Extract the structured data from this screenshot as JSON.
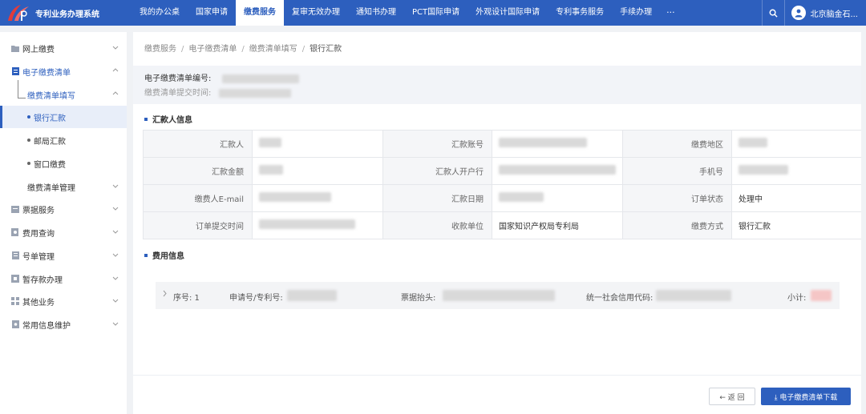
{
  "app": {
    "title": "专利业务办理系统"
  },
  "nav": {
    "items": [
      "我的办公桌",
      "国家申请",
      "缴费服务",
      "复审无效办理",
      "通知书办理",
      "PCT国际申请",
      "外观设计国际申请",
      "专利事务服务",
      "手续办理"
    ],
    "active_index": 2,
    "more_label": "···"
  },
  "user": {
    "name": "北京脑金石..."
  },
  "sidebar": {
    "items": [
      {
        "label": "网上缴费",
        "icon": "folder-icon"
      },
      {
        "label": "电子缴费清单",
        "icon": "document-icon"
      },
      {
        "label": "缴费清单填写"
      },
      {
        "label": "银行汇款"
      },
      {
        "label": "邮局汇款"
      },
      {
        "label": "窗口缴费"
      },
      {
        "label": "缴费清单管理"
      },
      {
        "label": "票据服务",
        "icon": "receipt-icon"
      },
      {
        "label": "费用查询",
        "icon": "search-doc-icon"
      },
      {
        "label": "号单管理",
        "icon": "list-icon"
      },
      {
        "label": "暂存款办理",
        "icon": "deposit-icon"
      },
      {
        "label": "其他业务",
        "icon": "grid-icon"
      },
      {
        "label": "常用信息维护",
        "icon": "settings-doc-icon"
      }
    ]
  },
  "breadcrumb": [
    "缴费服务",
    "电子缴费清单",
    "缴费清单填写",
    "银行汇款"
  ],
  "info": {
    "list_no_label": "电子缴费清单编号:",
    "submit_time_label": "缴费清单提交时间:"
  },
  "sections": {
    "remitter_title": "汇款人信息",
    "fee_title": "费用信息"
  },
  "detail": {
    "rows": [
      [
        {
          "label": "汇款人",
          "value": ""
        },
        {
          "label": "汇款账号",
          "value": ""
        },
        {
          "label": "缴费地区",
          "value": ""
        }
      ],
      [
        {
          "label": "汇款金额",
          "value": ""
        },
        {
          "label": "汇款人开户行",
          "value": ""
        },
        {
          "label": "手机号",
          "value": ""
        }
      ],
      [
        {
          "label": "缴费人E-mail",
          "value": ""
        },
        {
          "label": "汇款日期",
          "value": ""
        },
        {
          "label": "订单状态",
          "value": "处理中"
        }
      ],
      [
        {
          "label": "订单提交时间",
          "value": ""
        },
        {
          "label": "收款单位",
          "value": "国家知识产权局专利局"
        },
        {
          "label": "缴费方式",
          "value": "银行汇款"
        }
      ]
    ]
  },
  "fee": {
    "seq_label": "序号: 1",
    "app_no_label": "申请号/专利号:",
    "invoice_title_label": "票据抬头:",
    "credit_code_label": "统一社会信用代码:",
    "subtotal_label": "小计:"
  },
  "buttons": {
    "back": "← 返 回",
    "download": "⤓ 电子缴费清单下载"
  },
  "colors": {
    "primary": "#2d5fbe"
  }
}
